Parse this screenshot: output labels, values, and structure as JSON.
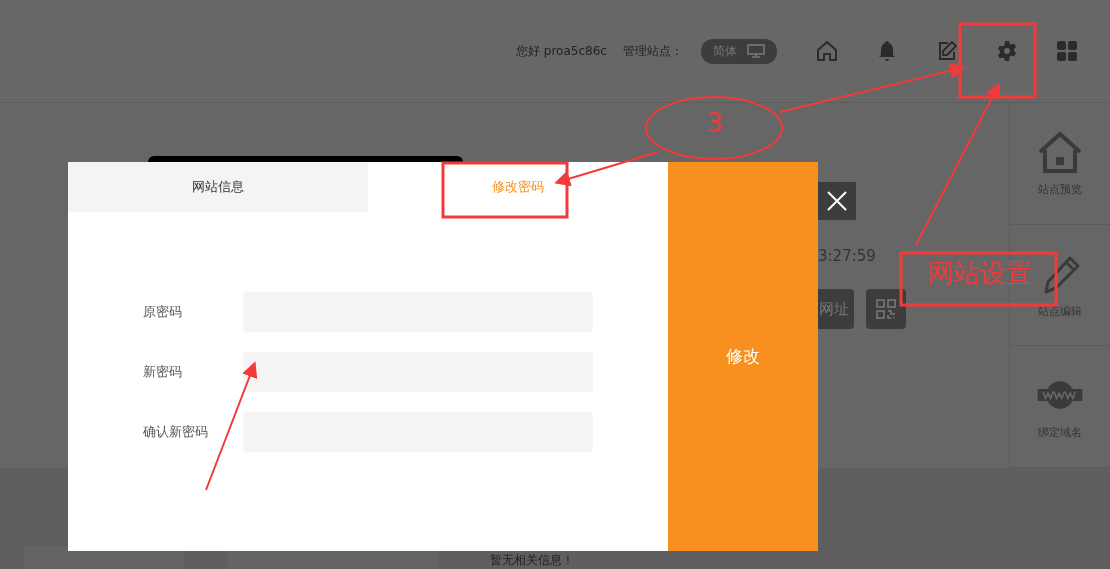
{
  "header": {
    "greeting": "您好 proa5c86c",
    "manage_label": "管理站点：",
    "language_toggle": {
      "label": "简体"
    },
    "nav": [
      {
        "kind": "home"
      },
      {
        "kind": "bell"
      },
      {
        "kind": "edit"
      },
      {
        "kind": "settings"
      },
      {
        "kind": "apps"
      }
    ]
  },
  "site_card": {
    "time": "3:27:59",
    "url_button": "网址"
  },
  "sidebar": {
    "items": [
      {
        "kind": "preview",
        "label": "站点预览"
      },
      {
        "kind": "edit",
        "label": "站点编辑"
      },
      {
        "kind": "domain",
        "label": "绑定域名"
      }
    ]
  },
  "empty_message": "暂无相关信息！",
  "dialog": {
    "tabs": [
      {
        "label": "网站信息",
        "selected": false
      },
      {
        "label": "修改密码",
        "selected": true
      }
    ],
    "fields": [
      {
        "label": "原密码"
      },
      {
        "label": "新密码"
      },
      {
        "label": "确认新密码"
      }
    ],
    "submit": "修改"
  },
  "annotations": {
    "step_number": "3",
    "callout": "网站设置"
  }
}
